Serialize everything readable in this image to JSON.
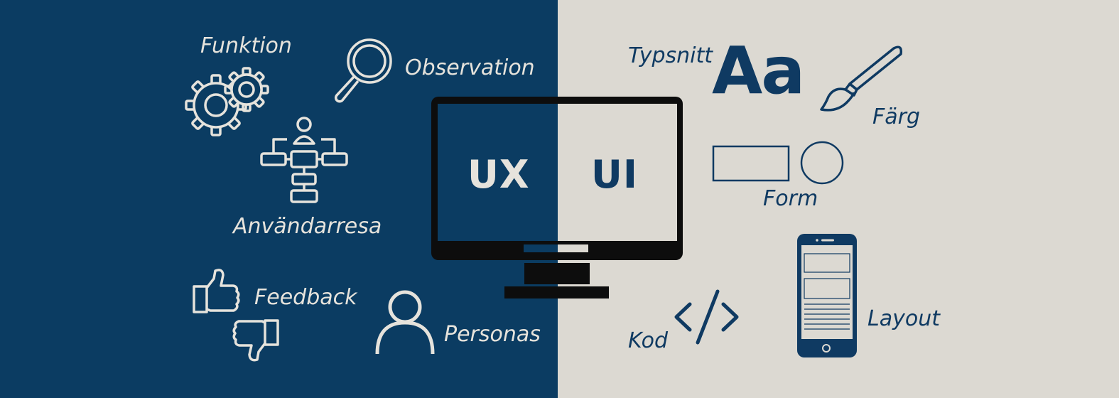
{
  "colors": {
    "navy": "#0b3c62",
    "beige": "#dcd9d2",
    "light_line": "#e6e3dc",
    "dark_line": "#0f3a62",
    "monitor": "#0d0d0d"
  },
  "screen": {
    "ux": "UX",
    "ui": "UI"
  },
  "typography_sample": "Aa",
  "labels": {
    "funktion": "Funktion",
    "observation": "Observation",
    "anvandarresa": "Användarresa",
    "feedback": "Feedback",
    "personas": "Personas",
    "typsnitt": "Typsnitt",
    "farg": "Färg",
    "form": "Form",
    "kod": "Kod",
    "layout": "Layout"
  },
  "icons": {
    "left": [
      "gears-icon",
      "magnifier-icon",
      "flowchart-icon",
      "thumbs-up-icon",
      "thumbs-down-icon",
      "person-icon"
    ],
    "right": [
      "paintbrush-icon",
      "rectangle-icon",
      "circle-icon",
      "code-icon",
      "smartphone-icon"
    ]
  }
}
